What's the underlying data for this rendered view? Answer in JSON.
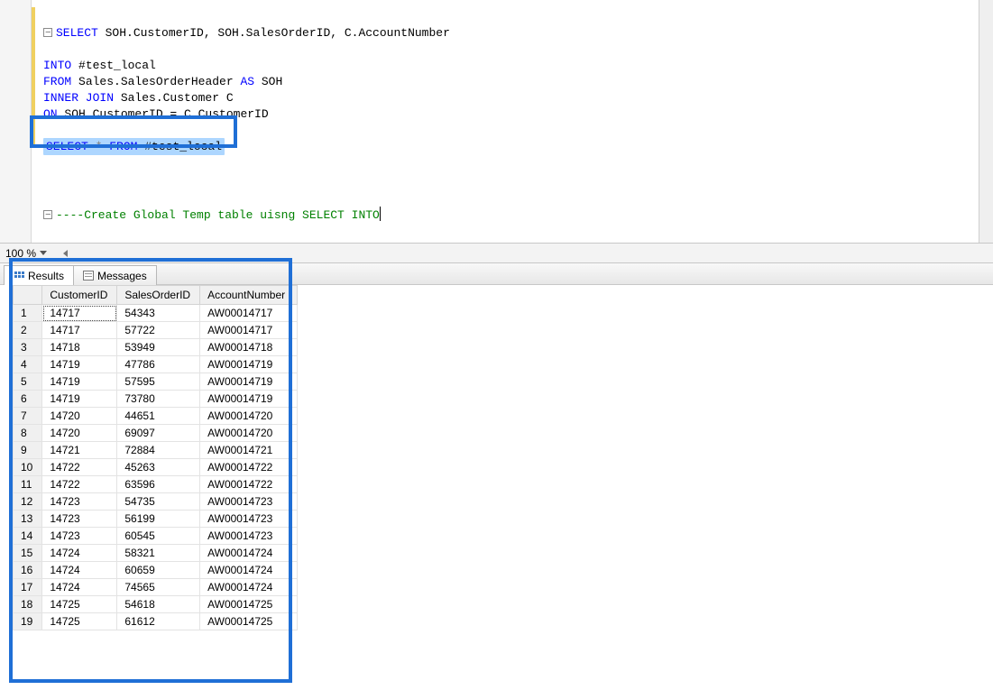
{
  "editor": {
    "line1": {
      "select": "SELECT",
      "rest": " SOH.CustomerID, SOH.SalesOrderID, C.AccountNumber"
    },
    "into": {
      "kw": "INTO",
      "rest": " #test_local"
    },
    "from": {
      "kw": "FROM",
      "rest": " Sales.SalesOrderHeader ",
      "as": "AS",
      "alias": " SOH"
    },
    "join": {
      "kw": "INNER JOIN",
      "rest": " Sales.Customer C"
    },
    "on": {
      "kw": "ON",
      "rest": " SOH.CustomerID = C.CustomerID"
    },
    "line7": {
      "sel": "SELECT ",
      "star": "*",
      "from": " FROM",
      "rest": " #test_local"
    },
    "comment": "----Create Global Temp table uisng SELECT INTO"
  },
  "zoom": {
    "value": "100 %"
  },
  "tabs": {
    "results": "Results",
    "messages": "Messages"
  },
  "grid": {
    "headers": {
      "c1": "CustomerID",
      "c2": "SalesOrderID",
      "c3": "AccountNumber"
    },
    "rows": [
      {
        "n": "1",
        "c1": "14717",
        "c2": "54343",
        "c3": "AW00014717"
      },
      {
        "n": "2",
        "c1": "14717",
        "c2": "57722",
        "c3": "AW00014717"
      },
      {
        "n": "3",
        "c1": "14718",
        "c2": "53949",
        "c3": "AW00014718"
      },
      {
        "n": "4",
        "c1": "14719",
        "c2": "47786",
        "c3": "AW00014719"
      },
      {
        "n": "5",
        "c1": "14719",
        "c2": "57595",
        "c3": "AW00014719"
      },
      {
        "n": "6",
        "c1": "14719",
        "c2": "73780",
        "c3": "AW00014719"
      },
      {
        "n": "7",
        "c1": "14720",
        "c2": "44651",
        "c3": "AW00014720"
      },
      {
        "n": "8",
        "c1": "14720",
        "c2": "69097",
        "c3": "AW00014720"
      },
      {
        "n": "9",
        "c1": "14721",
        "c2": "72884",
        "c3": "AW00014721"
      },
      {
        "n": "10",
        "c1": "14722",
        "c2": "45263",
        "c3": "AW00014722"
      },
      {
        "n": "11",
        "c1": "14722",
        "c2": "63596",
        "c3": "AW00014722"
      },
      {
        "n": "12",
        "c1": "14723",
        "c2": "54735",
        "c3": "AW00014723"
      },
      {
        "n": "13",
        "c1": "14723",
        "c2": "56199",
        "c3": "AW00014723"
      },
      {
        "n": "14",
        "c1": "14723",
        "c2": "60545",
        "c3": "AW00014723"
      },
      {
        "n": "15",
        "c1": "14724",
        "c2": "58321",
        "c3": "AW00014724"
      },
      {
        "n": "16",
        "c1": "14724",
        "c2": "60659",
        "c3": "AW00014724"
      },
      {
        "n": "17",
        "c1": "14724",
        "c2": "74565",
        "c3": "AW00014724"
      },
      {
        "n": "18",
        "c1": "14725",
        "c2": "54618",
        "c3": "AW00014725"
      },
      {
        "n": "19",
        "c1": "14725",
        "c2": "61612",
        "c3": "AW00014725"
      }
    ]
  }
}
